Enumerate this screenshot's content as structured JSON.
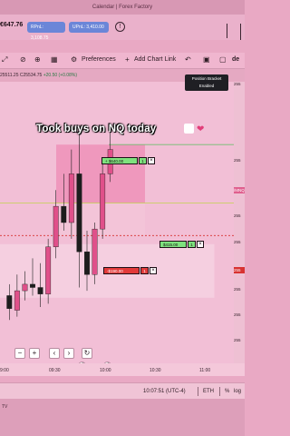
{
  "top": {
    "site_label": "Calendar | Forex Factory"
  },
  "account": {
    "value": "€647.76",
    "rpnl_label": "RPnL: 3,108.75",
    "upnl_label": "UPnL: 3,410.00"
  },
  "toolbar": {
    "preferences_label": "Preferences",
    "add_chart_link_label": "Add Chart Link",
    "right_text": "de"
  },
  "ohlc": {
    "prefix": "25511.25 C25534.75",
    "change": "+20.50 (+0.08%)"
  },
  "position_bracket": {
    "line1": "Position Bracket",
    "line2": "Enabled"
  },
  "overlay_caption": "Took buys on NQ today",
  "orders": {
    "take_profit_label": "+ $640.00",
    "take_profit_qty": "1",
    "entry_label": "$415.00",
    "entry_qty": "1",
    "stop_label": "-$190.00",
    "stop_qty": "1"
  },
  "price_axis": {
    "ticks": [
      "255",
      "255",
      "/MNQ",
      "255",
      "255",
      "255",
      "255",
      "255",
      "255"
    ],
    "tag_mnq": "/MNQ",
    "tag_price": "255"
  },
  "time_axis": {
    "ticks": [
      "9:00",
      "09:30",
      "10:00",
      "10:30",
      "11:00"
    ]
  },
  "status": {
    "time": "10:07:51 (UTC-4)",
    "exchange": "ETH",
    "percent": "%",
    "log": "log"
  },
  "bottom": {
    "brand": "TV"
  },
  "chart_data": {
    "type": "candlestick",
    "symbol": "/MNQ",
    "x": [
      "9:00",
      "09:30",
      "10:00",
      "10:30",
      "11:00"
    ],
    "candles": [
      {
        "o": 25455,
        "h": 25462,
        "l": 25440,
        "c": 25447
      },
      {
        "o": 25446,
        "h": 25468,
        "l": 25442,
        "c": 25458
      },
      {
        "o": 25458,
        "h": 25470,
        "l": 25452,
        "c": 25462
      },
      {
        "o": 25462,
        "h": 25478,
        "l": 25455,
        "c": 25460
      },
      {
        "o": 25460,
        "h": 25475,
        "l": 25448,
        "c": 25456
      },
      {
        "o": 25456,
        "h": 25490,
        "l": 25450,
        "c": 25485
      },
      {
        "o": 25485,
        "h": 25520,
        "l": 25478,
        "c": 25510
      },
      {
        "o": 25510,
        "h": 25530,
        "l": 25495,
        "c": 25500
      },
      {
        "o": 25500,
        "h": 25545,
        "l": 25490,
        "c": 25530
      },
      {
        "o": 25530,
        "h": 25560,
        "l": 25460,
        "c": 25482
      },
      {
        "o": 25482,
        "h": 25495,
        "l": 25458,
        "c": 25468
      },
      {
        "o": 25468,
        "h": 25500,
        "l": 25462,
        "c": 25496
      },
      {
        "o": 25496,
        "h": 25540,
        "l": 25490,
        "c": 25530
      },
      {
        "o": 25530,
        "h": 25560,
        "l": 25525,
        "c": 25545
      }
    ],
    "ylim": [
      25420,
      25580
    ],
    "take_profit": 25548,
    "entry": 25512,
    "stop": 25492
  }
}
